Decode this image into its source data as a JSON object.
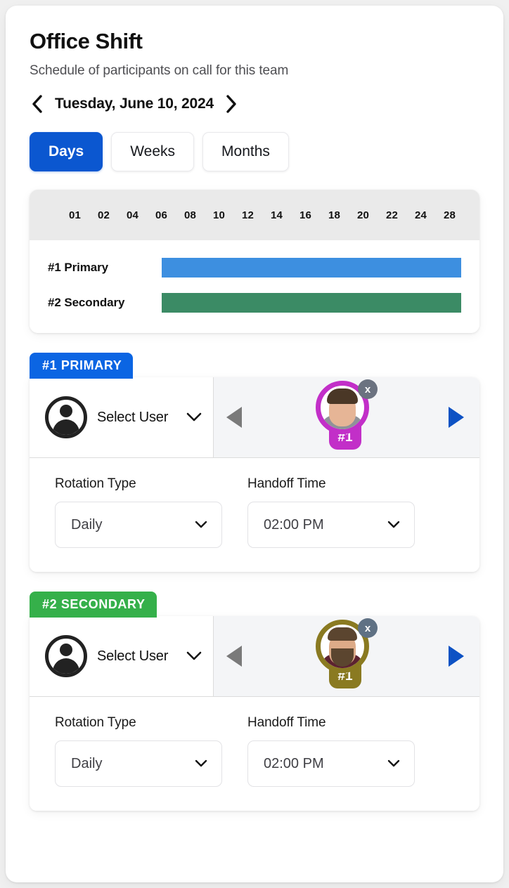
{
  "header": {
    "title": "Office Shift",
    "subtitle": "Schedule of participants on call for this team",
    "prev_icon": "chevron-left-icon",
    "next_icon": "chevron-right-icon",
    "current_date": "Tuesday, June 10, 2024"
  },
  "tabs": [
    {
      "label": "Days",
      "active": true
    },
    {
      "label": "Weeks",
      "active": false
    },
    {
      "label": "Months",
      "active": false
    }
  ],
  "timeline": {
    "ticks": [
      "01",
      "02",
      "04",
      "06",
      "08",
      "10",
      "12",
      "14",
      "16",
      "18",
      "20",
      "22",
      "24",
      "28"
    ],
    "rows": [
      {
        "label": "#1 Primary",
        "color": "#3d8fe0"
      },
      {
        "label": "#2 Secondary",
        "color": "#3b8b65"
      }
    ]
  },
  "roles": [
    {
      "badge": "#1 PRIMARY",
      "badge_color": "#0b65e3",
      "user_select_label": "Select User",
      "avatar_icon": "user-avatar-placeholder-icon",
      "chevron_icon": "chevron-down-icon",
      "prev_icon": "triangle-left-icon",
      "next_icon": "triangle-right-icon",
      "person": {
        "tag": "#1",
        "ring_color": "#c22fc8",
        "remove_label": "x"
      },
      "rotation": {
        "label": "Rotation Type",
        "value": "Daily"
      },
      "handoff": {
        "label": "Handoff Time",
        "value": "02:00 PM"
      }
    },
    {
      "badge": "#2 SECONDARY",
      "badge_color": "#35b04a",
      "user_select_label": "Select User",
      "avatar_icon": "user-avatar-placeholder-icon",
      "chevron_icon": "chevron-down-icon",
      "prev_icon": "triangle-left-icon",
      "next_icon": "triangle-right-icon",
      "person": {
        "tag": "#1",
        "ring_color": "#8a7a21",
        "remove_label": "x"
      },
      "rotation": {
        "label": "Rotation Type",
        "value": "Daily"
      },
      "handoff": {
        "label": "Handoff Time",
        "value": "02:00 PM"
      }
    }
  ]
}
